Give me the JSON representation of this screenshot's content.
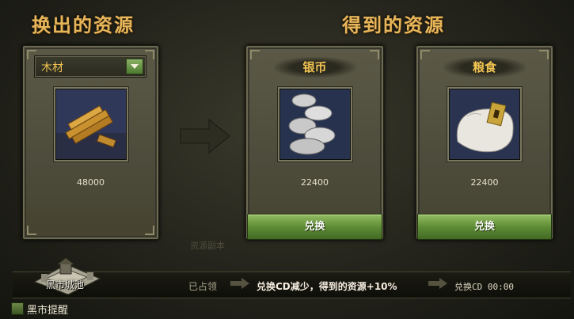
{
  "sections": {
    "give_title": "换出的资源",
    "get_title": "得到的资源"
  },
  "give": {
    "selected_resource": "木材",
    "amount": "48000",
    "icon": "wood-icon"
  },
  "receive": [
    {
      "name": "银币",
      "amount": "22400",
      "button": "兑换",
      "icon": "silver-coins-icon"
    },
    {
      "name": "粮食",
      "amount": "22400",
      "button": "兑换",
      "icon": "grain-sack-icon"
    }
  ],
  "status": {
    "city_name": "黑市城池",
    "occupied_label": "已占领",
    "bonus_desc": "兑换CD减少，得到的资源+10%",
    "cd_label": "兑换CD 00:00"
  },
  "faint_text": "资源副本",
  "reminder": {
    "label": "黑市提醒",
    "checked": false
  },
  "colors": {
    "title": "#e7b65b",
    "button": "#5f8c36",
    "panel": "#4d4b3b"
  }
}
